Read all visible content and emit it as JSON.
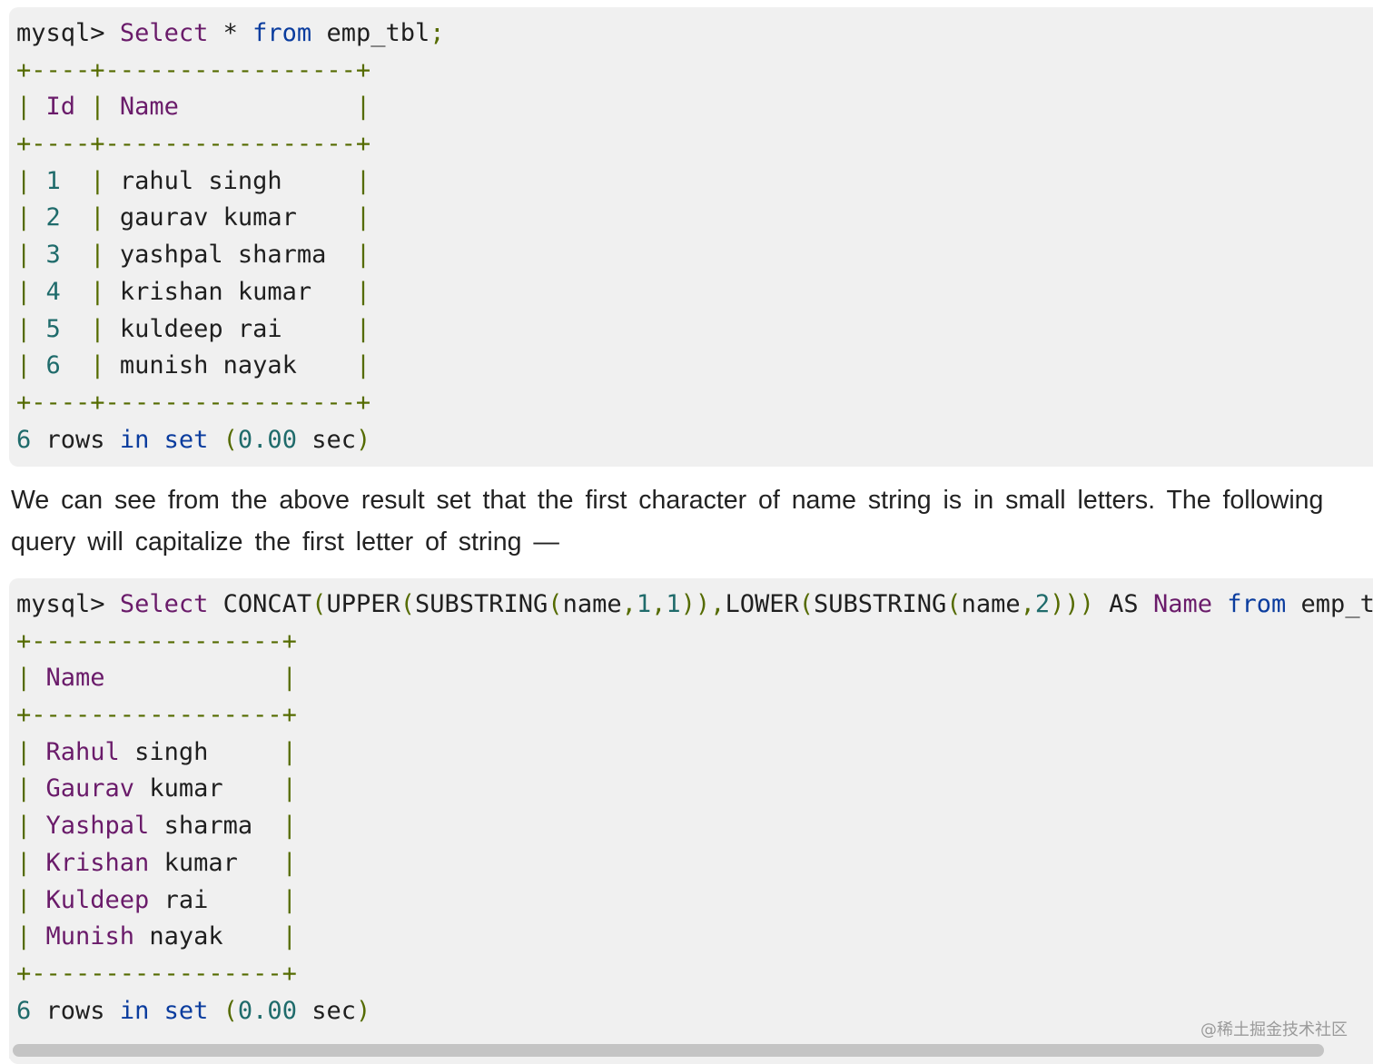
{
  "block1": {
    "prompt": "mysql>",
    "query": {
      "select": "Select",
      "star": "*",
      "from": "from",
      "table": "emp_tbl",
      "semi": ";"
    },
    "border": "+----+-----------------+",
    "header": {
      "col1": "Id",
      "col2": "Name"
    },
    "rows": [
      {
        "id": "1",
        "name": "rahul singh"
      },
      {
        "id": "2",
        "name": "gaurav kumar"
      },
      {
        "id": "3",
        "name": "yashpal sharma"
      },
      {
        "id": "4",
        "name": "krishan kumar"
      },
      {
        "id": "5",
        "name": "kuldeep rai"
      },
      {
        "id": "6",
        "name": "munish nayak"
      }
    ],
    "footer": {
      "count": "6",
      "rows": "rows",
      "in": "in",
      "set": "set",
      "time": "0.00",
      "sec": "sec"
    }
  },
  "prose": {
    "line1": "We can see from the above result set that the first character of name string is in small letters. The following",
    "line2": "query will capitalize the first letter of string —"
  },
  "block2": {
    "prompt": "mysql>",
    "query": {
      "select": "Select",
      "concat": "CONCAT",
      "upper": "UPPER",
      "substring1": "SUBSTRING",
      "arg1": "name",
      "n1": "1",
      "n2": "1",
      "lower": "LOWER",
      "substring2": "SUBSTRING",
      "arg2": "name",
      "n3": "2",
      "as": "AS",
      "alias": "Name",
      "from": "from",
      "table": "emp_tbl;"
    },
    "border": "+-----------------+",
    "header": {
      "col1": "Name"
    },
    "rows": [
      {
        "first": "Rahul",
        "last": "singh"
      },
      {
        "first": "Gaurav",
        "last": "kumar"
      },
      {
        "first": "Yashpal",
        "last": "sharma"
      },
      {
        "first": "Krishan",
        "last": "kumar"
      },
      {
        "first": "Kuldeep",
        "last": "rai"
      },
      {
        "first": "Munish",
        "last": "nayak"
      }
    ],
    "footer": {
      "count": "6",
      "rows": "rows",
      "in": "in",
      "set": "set",
      "time": "0.00",
      "sec": "sec"
    }
  },
  "watermark": "@稀土掘金技术社区"
}
